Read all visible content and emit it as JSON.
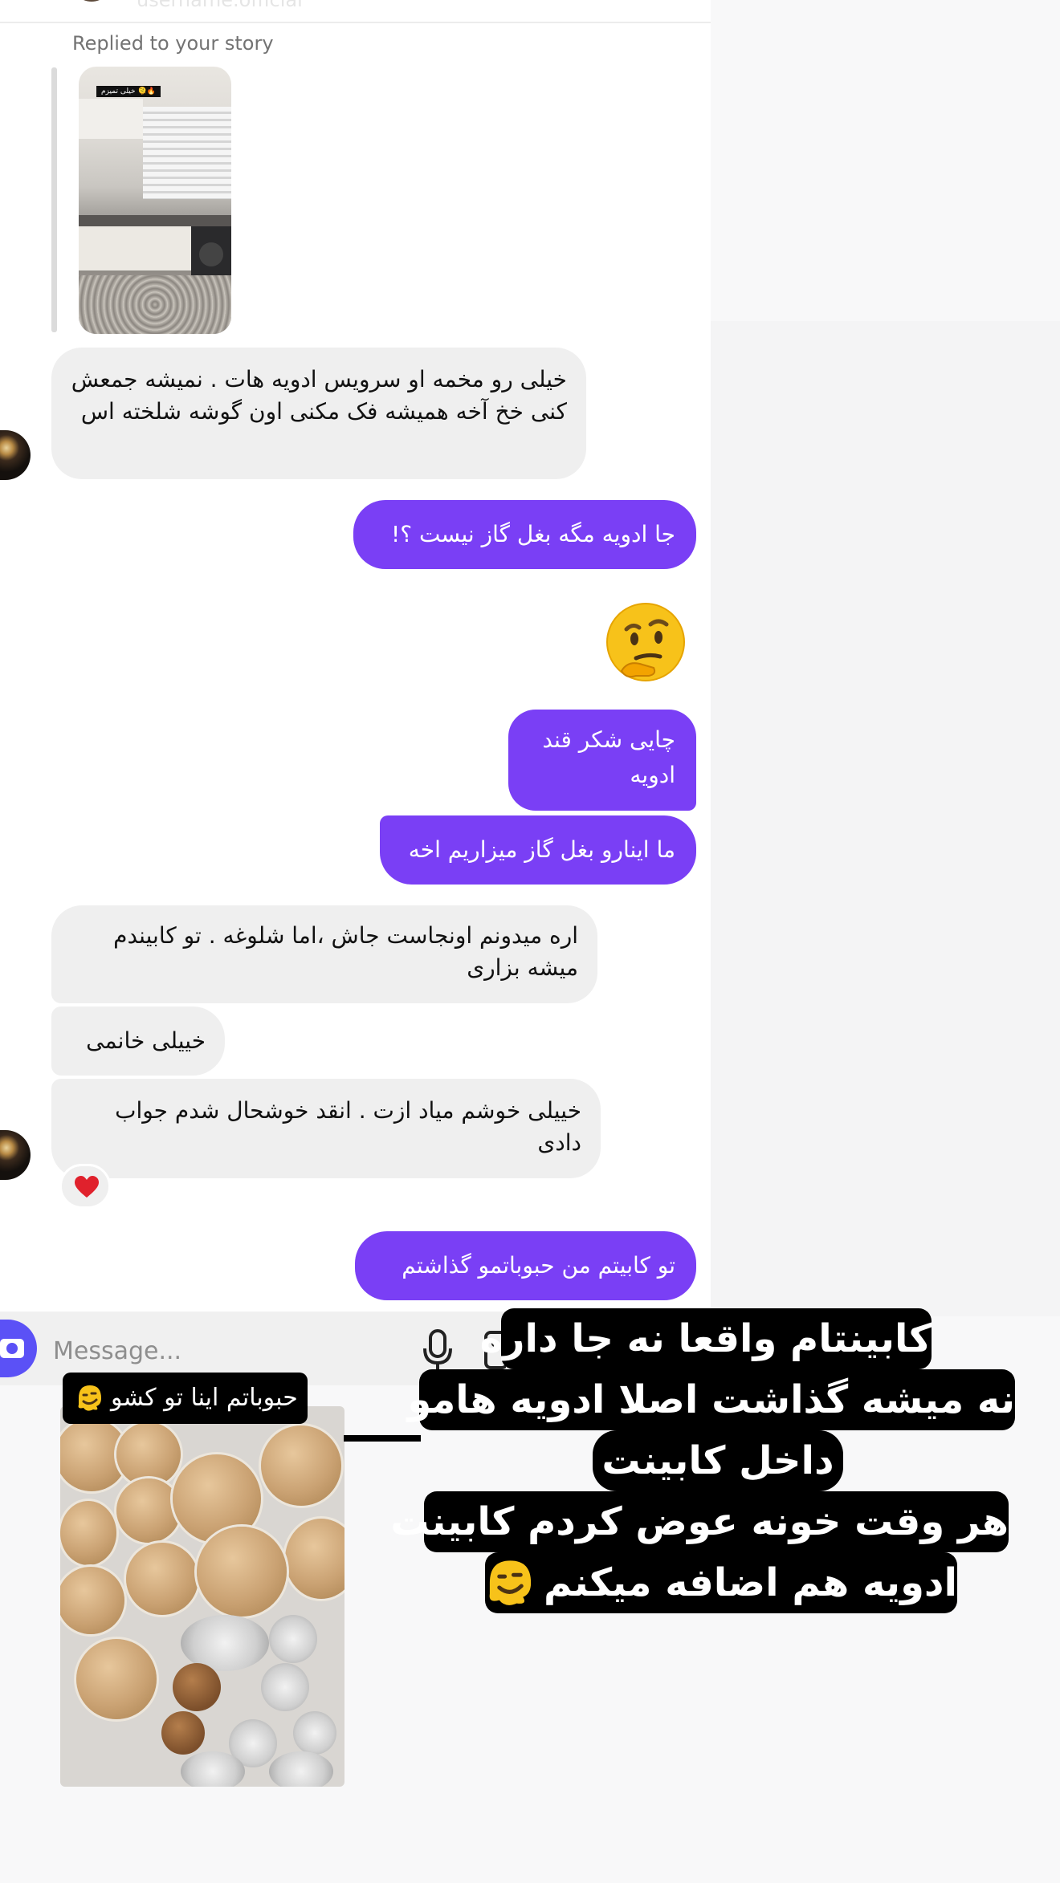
{
  "header": {
    "username_partial": "username.official"
  },
  "story_reply": {
    "label": "Replied to your story",
    "thumb_sticker": "خیلی تمیزم 🫠🔥"
  },
  "messages": [
    {
      "id": "m1",
      "dir": "in",
      "text": "خیلی رو مخمه او سرویس ادویه هات . نمیشه جمعش کنی خخ آخه همیشه فک مکنی اون گوشه شلخته اس"
    },
    {
      "id": "m2",
      "dir": "out",
      "text": "جا ادویه مگه بغل گاز نیست ؟!"
    },
    {
      "id": "m3",
      "dir": "out",
      "type": "emoji",
      "emoji": "thinking-face"
    },
    {
      "id": "m4",
      "dir": "out",
      "text": "چایی شکر قند ادویه"
    },
    {
      "id": "m5",
      "dir": "out",
      "text": "ما اینارو بغل گاز میزاریم اخه"
    },
    {
      "id": "m6",
      "dir": "in",
      "text": "اره میدونم  اونجاست جاش ،اما شلوغه . تو کابیندم میشه بزاری"
    },
    {
      "id": "m7",
      "dir": "in",
      "text": "خییلی خانمی"
    },
    {
      "id": "m8",
      "dir": "in",
      "text": "خییلی خوشم میاد ازت . انقد خوشحال شدم جواب دادی",
      "reaction": "red-heart"
    },
    {
      "id": "m9",
      "dir": "out",
      "text": "تو کابیتم من حبوباتمو گذاشتم"
    }
  ],
  "composer": {
    "placeholder": "Message...",
    "camera_icon": "camera-icon",
    "mic_icon": "mic-icon",
    "gallery_icon": "gallery-icon"
  },
  "overlay": {
    "drawer_caption": "حبوباتم اینا تو کشو",
    "caption_lines": [
      "کابینتام واقعا نه جا داره",
      "نه میشه گذاشت اصلا ادویه هامو",
      "داخل کابینت",
      "هر وقت خونه عوض کردم کابینت",
      "ادویه هم اضافه میکنم"
    ],
    "caption_emoji": "melting-face"
  },
  "colors": {
    "outgoing_bubble": "#7a3ff5",
    "incoming_bubble": "#efefef",
    "camera_button": "#5b51f6",
    "heart": "#e0212c"
  }
}
